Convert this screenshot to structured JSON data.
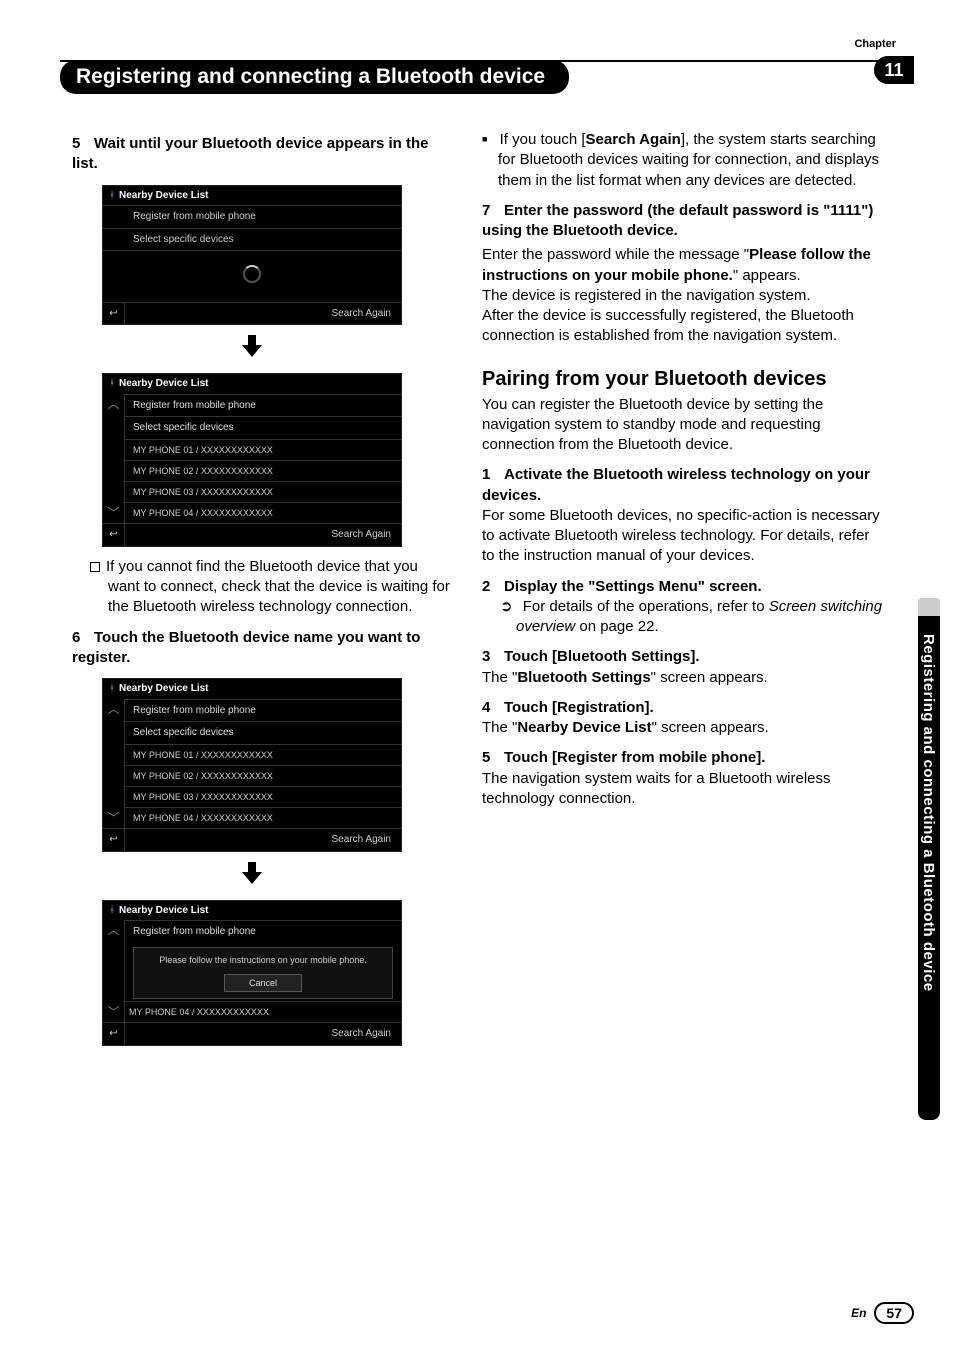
{
  "chapter_label": "Chapter",
  "chapter_num": "11",
  "header_title": "Registering and connecting a Bluetooth device",
  "side_tab": "Registering and connecting a Bluetooth device",
  "footer": {
    "lang": "En",
    "page": "57"
  },
  "left": {
    "step5": "Wait until your Bluetooth device appears in the list.",
    "step5_num": "5",
    "panelA": {
      "title": "Nearby Device List",
      "row1": "Register from mobile phone",
      "row2": "Select specific devices",
      "search": "Search Again"
    },
    "panelB": {
      "title": "Nearby Device List",
      "row1": "Register from mobile phone",
      "row2": "Select specific devices",
      "items": [
        "MY PHONE 01 / XXXXXXXXXXXX",
        "MY PHONE 02 / XXXXXXXXXXXX",
        "MY PHONE 03 / XXXXXXXXXXXX",
        "MY PHONE 04 / XXXXXXXXXXXX"
      ],
      "search": "Search Again"
    },
    "note5": "If you cannot find the Bluetooth device that you want to connect, check that the device is waiting for the Bluetooth wireless technology connection.",
    "step6_num": "6",
    "step6": "Touch the Bluetooth device name you want to register.",
    "panelC": {
      "title": "Nearby Device List",
      "row1": "Register from mobile phone",
      "row2": "Select specific devices",
      "items": [
        "MY PHONE 01 / XXXXXXXXXXXX",
        "MY PHONE 02 / XXXXXXXXXXXX",
        "MY PHONE 03 / XXXXXXXXXXXX",
        "MY PHONE 04 / XXXXXXXXXXXX"
      ],
      "search": "Search Again"
    },
    "panelD": {
      "title": "Nearby Device List",
      "row1": "Register from mobile phone",
      "modal": "Please follow the instructions on your mobile phone.",
      "cancel": "Cancel",
      "trailing": "MY PHONE 04 / XXXXXXXXXXXX",
      "search": "Search Again"
    }
  },
  "right": {
    "bullet1_a": "If you touch [",
    "bullet1_b": "Search Again",
    "bullet1_c": "], the system starts searching for Bluetooth devices waiting for connection, and displays them in the list format when any devices are detected.",
    "step7_num": "7",
    "step7": "Enter the password (the default password is \"1111\") using the Bluetooth device.",
    "p7a_a": "Enter the password while the message \"",
    "p7a_b": "Please follow the instructions on your mobile phone.",
    "p7a_c": "\" appears.",
    "p7b": "The device is registered in the navigation system.",
    "p7c": "After the device is successfully registered, the Bluetooth connection is established from the navigation system.",
    "h2": "Pairing from your Bluetooth devices",
    "intro": "You can register the Bluetooth device by setting the navigation system to standby mode and requesting connection from the Bluetooth device.",
    "s1_num": "1",
    "s1": "Activate the Bluetooth wireless technology on your devices.",
    "s1p": "For some Bluetooth devices, no specific-action is necessary to activate Bluetooth wireless technology. For details, refer to the instruction manual of your devices.",
    "s2_num": "2",
    "s2": "Display the \"Settings Menu\" screen.",
    "s2ref_a": "For details of the operations, refer to ",
    "s2ref_b": "Screen switching overview",
    "s2ref_c": " on page 22.",
    "s3_num": "3",
    "s3": "Touch [Bluetooth Settings].",
    "s3p_a": "The \"",
    "s3p_b": "Bluetooth Settings",
    "s3p_c": "\" screen appears.",
    "s4_num": "4",
    "s4": "Touch [Registration].",
    "s4p_a": "The \"",
    "s4p_b": "Nearby Device List",
    "s4p_c": "\" screen appears.",
    "s5_num": "5",
    "s5": "Touch [Register from mobile phone].",
    "s5p": "The navigation system waits for a Bluetooth wireless technology connection."
  }
}
